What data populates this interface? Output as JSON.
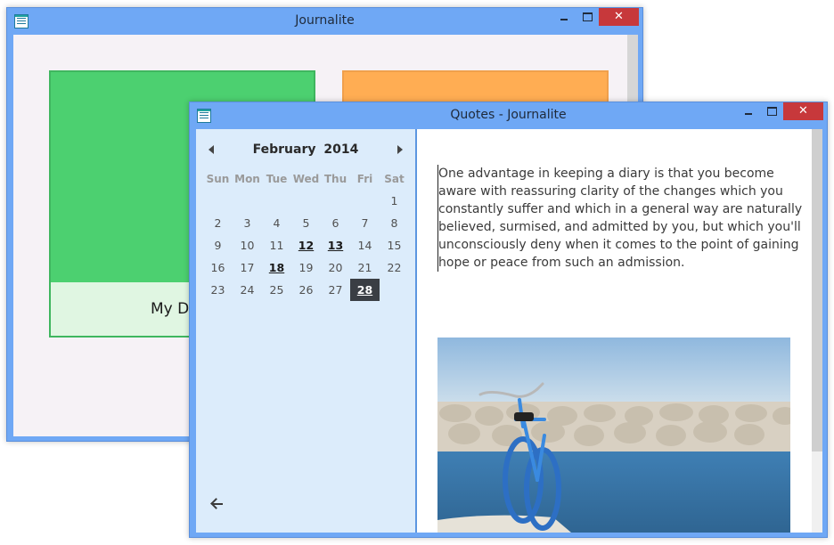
{
  "colors": {
    "titlebar": "#6fa8f5",
    "close_button": "#c7383b",
    "tile_green": "#4cd070",
    "tile_orange": "#ffad53",
    "sidebar": "#dcecfb",
    "selected_day": "#3a3e44"
  },
  "back_window": {
    "title": "Journalite",
    "close_glyph": "✕",
    "tiles": [
      {
        "caption": "My Di"
      }
    ]
  },
  "front_window": {
    "title": "Quotes - Journalite",
    "close_glyph": "✕",
    "calendar": {
      "month": "February",
      "year": "2014",
      "weekdays": [
        "Sun",
        "Mon",
        "Tue",
        "Wed",
        "Thu",
        "Fri",
        "Sat"
      ],
      "weeks": [
        [
          "",
          "",
          "",
          "",
          "",
          "",
          "1"
        ],
        [
          "2",
          "3",
          "4",
          "5",
          "6",
          "7",
          "8"
        ],
        [
          "9",
          "10",
          "11",
          "12",
          "13",
          "14",
          "15"
        ],
        [
          "16",
          "17",
          "18",
          "19",
          "20",
          "21",
          "22"
        ],
        [
          "23",
          "24",
          "25",
          "26",
          "27",
          "28",
          ""
        ]
      ],
      "entry_days": [
        "12",
        "13",
        "18",
        "28"
      ],
      "selected_day": "28"
    },
    "quote_text": "One advantage in keeping a diary is that you become aware with reassuring clarity of the changes which you constantly suffer and which in a general way are naturally believed, surmised, and admitted by you, but which you'll unconsciously deny when it comes to the point of gaining hope or peace from such an admission.",
    "image_subject": "blue bicycle by the sea"
  }
}
